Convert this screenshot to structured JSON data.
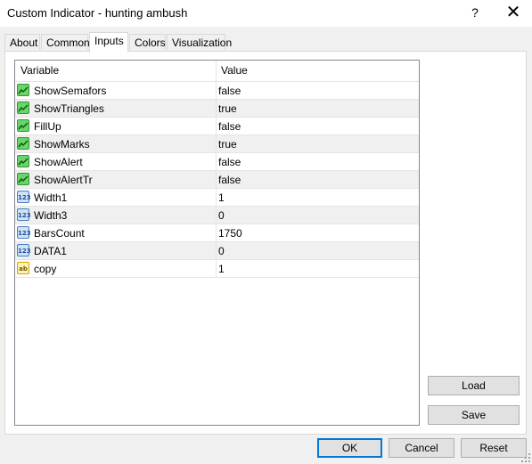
{
  "window": {
    "title": "Custom Indicator - hunting ambush",
    "help_glyph": "?",
    "close_glyph": "✕"
  },
  "tabs": [
    {
      "label": "About"
    },
    {
      "label": "Common"
    },
    {
      "label": "Inputs",
      "active": true
    },
    {
      "label": "Colors"
    },
    {
      "label": "Visualization"
    }
  ],
  "grid": {
    "headers": {
      "variable": "Variable",
      "value": "Value"
    },
    "rows": [
      {
        "icon": "bool-icon",
        "name": "ShowSemafors",
        "value": "false"
      },
      {
        "icon": "bool-icon",
        "name": "ShowTriangles",
        "value": "true"
      },
      {
        "icon": "bool-icon",
        "name": "FillUp",
        "value": "false"
      },
      {
        "icon": "bool-icon",
        "name": "ShowMarks",
        "value": "true"
      },
      {
        "icon": "bool-icon",
        "name": "ShowAlert",
        "value": "false"
      },
      {
        "icon": "bool-icon",
        "name": "ShowAlertTr",
        "value": "false"
      },
      {
        "icon": "integer-icon",
        "name": "Width1",
        "value": "1"
      },
      {
        "icon": "integer-icon",
        "name": "Width3",
        "value": "0"
      },
      {
        "icon": "integer-icon",
        "name": "BarsCount",
        "value": "1750"
      },
      {
        "icon": "integer-icon",
        "name": "DATA1",
        "value": "0"
      },
      {
        "icon": "string-icon",
        "name": "copy",
        "value": "1"
      }
    ]
  },
  "icons": {
    "integer_glyph": "123",
    "string_glyph": "ab"
  },
  "side_buttons": {
    "load": "Load",
    "save": "Save"
  },
  "footer_buttons": {
    "ok": "OK",
    "cancel": "Cancel",
    "reset": "Reset"
  }
}
